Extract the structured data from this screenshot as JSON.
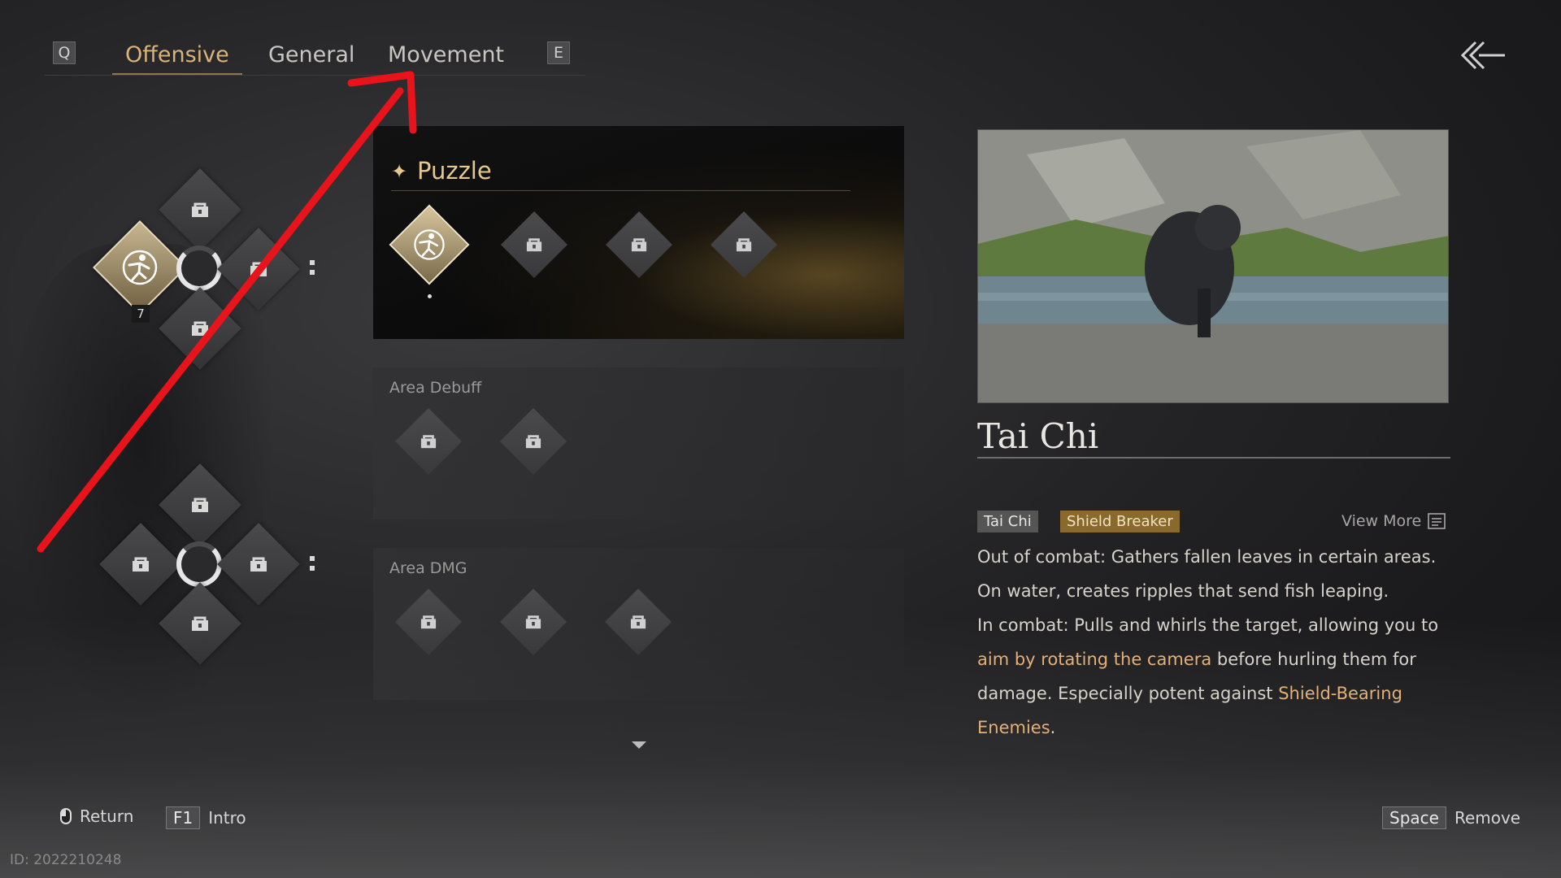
{
  "tabs": {
    "prev_key": "Q",
    "next_key": "E",
    "items": [
      {
        "label": "Offensive",
        "active": true
      },
      {
        "label": "General",
        "active": false
      },
      {
        "label": "Movement",
        "active": false
      }
    ]
  },
  "wheel": {
    "equipped_badge": "7"
  },
  "sections": {
    "puzzle": {
      "title": "Puzzle"
    },
    "area_debuff": {
      "title": "Area Debuff"
    },
    "area_dmg": {
      "title": "Area DMG"
    }
  },
  "detail": {
    "name": "Tai Chi",
    "tags": [
      "Tai Chi",
      "Shield Breaker"
    ],
    "view_more": "View More",
    "desc": {
      "p1": "Out of combat: Gathers fallen leaves in certain areas.",
      "p2": "On water, creates ripples that send fish leaping.",
      "p3a": "In combat: Pulls and whirls the target, allowing you to",
      "p3_hl1": "aim by rotating the camera",
      "p3b": " before hurling them for",
      "p3c": "damage. Especially potent against ",
      "p3_hl2a": "Shield-Bearing",
      "p3_hl2b": "Enemies",
      "p3d": "."
    }
  },
  "hints": {
    "return_label": "Return",
    "intro_key": "F1",
    "intro_label": "Intro",
    "remove_key": "Space",
    "remove_label": "Remove"
  },
  "id_text": "ID: 2022210248",
  "colors": {
    "accent_gold": "#d9b37a",
    "highlight": "#e3b078",
    "annotation_arrow": "#e8131b"
  }
}
